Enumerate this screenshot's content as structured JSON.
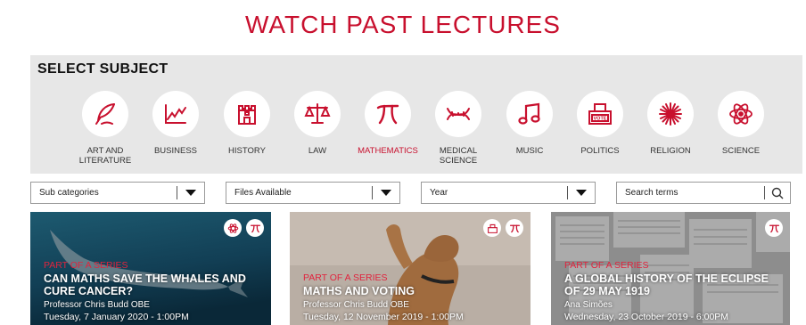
{
  "page": {
    "title": "WATCH PAST LECTURES"
  },
  "colors": {
    "accent": "#c8102e",
    "panel": "#e7e7e7"
  },
  "subjects": {
    "heading": "SELECT SUBJECT",
    "active": "MATHEMATICS",
    "items": [
      {
        "label": "ART AND LITERATURE",
        "icon": "quill-pen-icon"
      },
      {
        "label": "BUSINESS",
        "icon": "line-graph-icon"
      },
      {
        "label": "HISTORY",
        "icon": "castle-tower-icon"
      },
      {
        "label": "LAW",
        "icon": "scales-icon"
      },
      {
        "label": "MATHEMATICS",
        "icon": "pi-icon"
      },
      {
        "label": "MEDICAL SCIENCE",
        "icon": "dna-icon"
      },
      {
        "label": "MUSIC",
        "icon": "music-note-icon"
      },
      {
        "label": "POLITICS",
        "icon": "ballot-box-icon"
      },
      {
        "label": "RELIGION",
        "icon": "starburst-icon"
      },
      {
        "label": "SCIENCE",
        "icon": "atom-icon"
      }
    ]
  },
  "filters": {
    "sub_categories": "Sub categories",
    "files_available": "Files Available",
    "year": "Year",
    "search_placeholder": "Search terms"
  },
  "lectures": [
    {
      "series_tag": "PART OF A SERIES",
      "title": "CAN MATHS SAVE THE WHALES AND CURE CANCER?",
      "speaker": "Professor Chris Budd OBE",
      "date": "Tuesday, 7 January 2020 - 1:00PM",
      "badges": [
        "atom-icon",
        "pi-icon"
      ]
    },
    {
      "series_tag": "PART OF A SERIES",
      "title": "MATHS AND VOTING",
      "speaker": "Professor Chris Budd OBE",
      "date": "Tuesday, 12 November 2019 - 1:00PM",
      "badges": [
        "ballot-box-icon",
        "pi-icon"
      ]
    },
    {
      "series_tag": "PART OF A SERIES",
      "title": "A GLOBAL HISTORY OF THE ECLIPSE OF 29 MAY 1919",
      "speaker": "Ana Simões",
      "date": "Wednesday, 23 October 2019 - 6:00PM",
      "badges": [
        "pi-icon"
      ]
    }
  ]
}
